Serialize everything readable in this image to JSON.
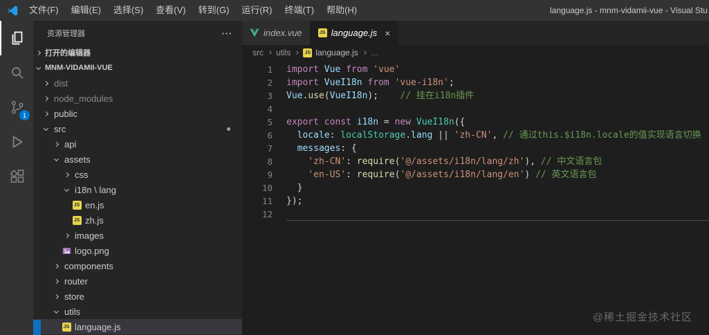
{
  "window": {
    "title": "language.js - mnm-vidamii-vue - Visual Stu"
  },
  "menu_bar": {
    "items": [
      {
        "id": "file",
        "label": "文件(F)"
      },
      {
        "id": "edit",
        "label": "编辑(E)"
      },
      {
        "id": "selection",
        "label": "选择(S)"
      },
      {
        "id": "view",
        "label": "查看(V)"
      },
      {
        "id": "go",
        "label": "转到(G)"
      },
      {
        "id": "run",
        "label": "运行(R)"
      },
      {
        "id": "terminal",
        "label": "终端(T)"
      },
      {
        "id": "help",
        "label": "帮助(H)"
      }
    ]
  },
  "activity_bar": {
    "items": [
      {
        "id": "explorer",
        "active": true
      },
      {
        "id": "search",
        "active": false
      },
      {
        "id": "source-control",
        "active": false,
        "badge": "1"
      },
      {
        "id": "run-debug",
        "active": false
      },
      {
        "id": "extensions",
        "active": false
      }
    ]
  },
  "sidebar": {
    "header": "资源管理器",
    "more_actions": "⋯",
    "open_editors_label": "打开的编辑器",
    "root_label": "MNM-VIDAMII-VUE",
    "tree": [
      {
        "label": "dist",
        "kind": "folder",
        "state": "collapsed",
        "depth": 0,
        "dim": true
      },
      {
        "label": "node_modules",
        "kind": "folder",
        "state": "collapsed",
        "depth": 0,
        "dim": true
      },
      {
        "label": "public",
        "kind": "folder",
        "state": "collapsed",
        "depth": 0
      },
      {
        "label": "src",
        "kind": "folder",
        "state": "expanded",
        "depth": 0,
        "marker_dot": true
      },
      {
        "label": "api",
        "kind": "folder",
        "state": "collapsed",
        "depth": 1
      },
      {
        "label": "assets",
        "kind": "folder",
        "state": "expanded",
        "depth": 1
      },
      {
        "label": "css",
        "kind": "folder",
        "state": "collapsed",
        "depth": 2
      },
      {
        "label": "i18n \\ lang",
        "kind": "folder",
        "state": "expanded",
        "depth": 2
      },
      {
        "label": "en.js",
        "kind": "js",
        "depth": 3
      },
      {
        "label": "zh.js",
        "kind": "js",
        "depth": 3
      },
      {
        "label": "images",
        "kind": "folder",
        "state": "collapsed",
        "depth": 2
      },
      {
        "label": "logo.png",
        "kind": "image",
        "depth": 2
      },
      {
        "label": "components",
        "kind": "folder",
        "state": "collapsed",
        "depth": 1
      },
      {
        "label": "router",
        "kind": "folder",
        "state": "collapsed",
        "depth": 1
      },
      {
        "label": "store",
        "kind": "folder",
        "state": "collapsed",
        "depth": 1
      },
      {
        "label": "utils",
        "kind": "folder",
        "state": "expanded",
        "depth": 1
      },
      {
        "label": "language.js",
        "kind": "js",
        "depth": 2,
        "selected": true
      }
    ]
  },
  "editor": {
    "tabs": [
      {
        "label": "index.vue",
        "icon": "vue",
        "active": false
      },
      {
        "label": "language.js",
        "icon": "js",
        "active": true
      }
    ],
    "close_glyph": "×",
    "breadcrumbs": {
      "path": [
        "src",
        "utils"
      ],
      "file": "language.js",
      "trailing": "…"
    },
    "code_lines": [
      {
        "n": "1",
        "t": [
          [
            "kw",
            "import "
          ],
          [
            "var",
            "Vue"
          ],
          [
            "kw",
            " from "
          ],
          [
            "str",
            "'vue'"
          ]
        ]
      },
      {
        "n": "2",
        "t": [
          [
            "kw",
            "import "
          ],
          [
            "var",
            "VueI18n"
          ],
          [
            "kw",
            " from "
          ],
          [
            "str",
            "'vue-i18n'"
          ],
          [
            "pun",
            ";"
          ]
        ]
      },
      {
        "n": "3",
        "t": [
          [
            "var",
            "Vue"
          ],
          [
            "pun",
            "."
          ],
          [
            "fn",
            "use"
          ],
          [
            "pun",
            "("
          ],
          [
            "var",
            "VueI18n"
          ],
          [
            "pun",
            ");"
          ],
          [
            "pln",
            "    "
          ],
          [
            "com",
            "// 挂在i18n插件"
          ]
        ]
      },
      {
        "n": "4",
        "t": []
      },
      {
        "n": "5",
        "t": [
          [
            "kw",
            "export "
          ],
          [
            "kw",
            "const "
          ],
          [
            "var",
            "i18n "
          ],
          [
            "pun",
            "= "
          ],
          [
            "kw",
            "new "
          ],
          [
            "cls",
            "VueI18n"
          ],
          [
            "pun",
            "({"
          ]
        ]
      },
      {
        "n": "6",
        "t": [
          [
            "pln",
            "  "
          ],
          [
            "var",
            "locale"
          ],
          [
            "pun",
            ": "
          ],
          [
            "cls",
            "localStorage"
          ],
          [
            "pun",
            "."
          ],
          [
            "var",
            "lang"
          ],
          [
            "pun",
            " || "
          ],
          [
            "str",
            "'zh-CN'"
          ],
          [
            "pun",
            ", "
          ],
          [
            "com",
            "// 通过this.$i18n.locale的值实现语言切换"
          ]
        ]
      },
      {
        "n": "7",
        "t": [
          [
            "pln",
            "  "
          ],
          [
            "var",
            "messages"
          ],
          [
            "pun",
            ": {"
          ]
        ]
      },
      {
        "n": "8",
        "t": [
          [
            "pln",
            "    "
          ],
          [
            "str",
            "'zh-CN'"
          ],
          [
            "pun",
            ": "
          ],
          [
            "fn",
            "require"
          ],
          [
            "pun",
            "("
          ],
          [
            "str",
            "'@/assets/i18n/lang/zh'"
          ],
          [
            "pun",
            "), "
          ],
          [
            "com",
            "// 中文语言包"
          ]
        ]
      },
      {
        "n": "9",
        "t": [
          [
            "pln",
            "    "
          ],
          [
            "str",
            "'en-US'"
          ],
          [
            "pun",
            ": "
          ],
          [
            "fn",
            "require"
          ],
          [
            "pun",
            "("
          ],
          [
            "str",
            "'@/assets/i18n/lang/en'"
          ],
          [
            "pun",
            ") "
          ],
          [
            "com",
            "// 英文语言包"
          ]
        ]
      },
      {
        "n": "10",
        "t": [
          [
            "pln",
            "  "
          ],
          [
            "pun",
            "}"
          ]
        ]
      },
      {
        "n": "11",
        "t": [
          [
            "pun",
            "});"
          ]
        ]
      },
      {
        "n": "12",
        "current": true,
        "t": []
      }
    ]
  },
  "watermark": "@稀土掘金技术社区",
  "colors": {
    "titlebar_bg": "#333333",
    "sidebar_bg": "#252526",
    "editor_bg": "#1e1e1e",
    "selected_row_bg": "#37373d",
    "badge_blue": "#0078d4",
    "keyword": "#c586c0",
    "string": "#ce9178",
    "comment": "#6a9955",
    "variable": "#9cdcfe",
    "class_name": "#4ec9b0",
    "function_name": "#dcdcaa",
    "vue_green": "#41b883",
    "js_yellow": "#e8d44d"
  }
}
